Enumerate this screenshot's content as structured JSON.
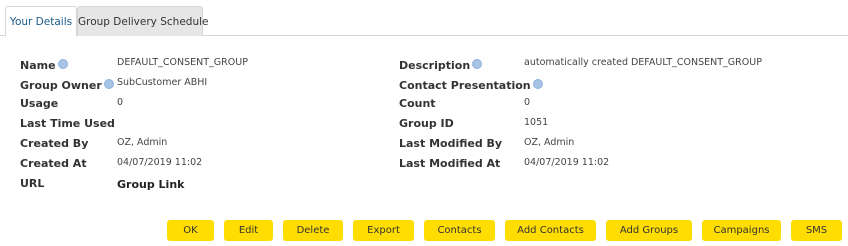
{
  "tabs": [
    {
      "label": "Your Details",
      "active": true
    },
    {
      "label": "Group Delivery Schedule",
      "active": false
    }
  ],
  "fields": {
    "name": {
      "label": "Name",
      "value": "DEFAULT_CONSENT_GROUP"
    },
    "group_owner": {
      "label": "Group Owner",
      "value": "SubCustomer ABHI"
    },
    "usage": {
      "label": "Usage",
      "value": "0"
    },
    "last_time_used": {
      "label": "Last Time Used",
      "value": ""
    },
    "created_by": {
      "label": "Created By",
      "value": "OZ, Admin"
    },
    "created_at": {
      "label": "Created At",
      "value": "04/07/2019 11:02"
    },
    "url": {
      "label": "URL",
      "value": "Group Link"
    },
    "description": {
      "label": "Description",
      "value": "automatically created DEFAULT_CONSENT_GROUP"
    },
    "contact_presentation": {
      "label": "Contact Presentation",
      "value": ""
    },
    "count": {
      "label": "Count",
      "value": "0"
    },
    "group_id": {
      "label": "Group ID",
      "value": "1051"
    },
    "last_modified_by": {
      "label": "Last Modified By",
      "value": "OZ, Admin"
    },
    "last_modified_at": {
      "label": "Last Modified At",
      "value": "04/07/2019 11:02"
    }
  },
  "buttons": {
    "ok": "OK",
    "edit": "Edit",
    "delete": "Delete",
    "export": "Export",
    "contacts": "Contacts",
    "add_contacts": "Add Contacts",
    "add_groups": "Add Groups",
    "campaigns": "Campaigns",
    "sms": "SMS"
  },
  "icons": {
    "info": "info-icon"
  },
  "colors": {
    "button_bg": "#ffdd00",
    "active_tab_text": "#1a5a8a",
    "inactive_tab_bg": "#e6e6e6",
    "info_icon": "#a6c4e6"
  }
}
